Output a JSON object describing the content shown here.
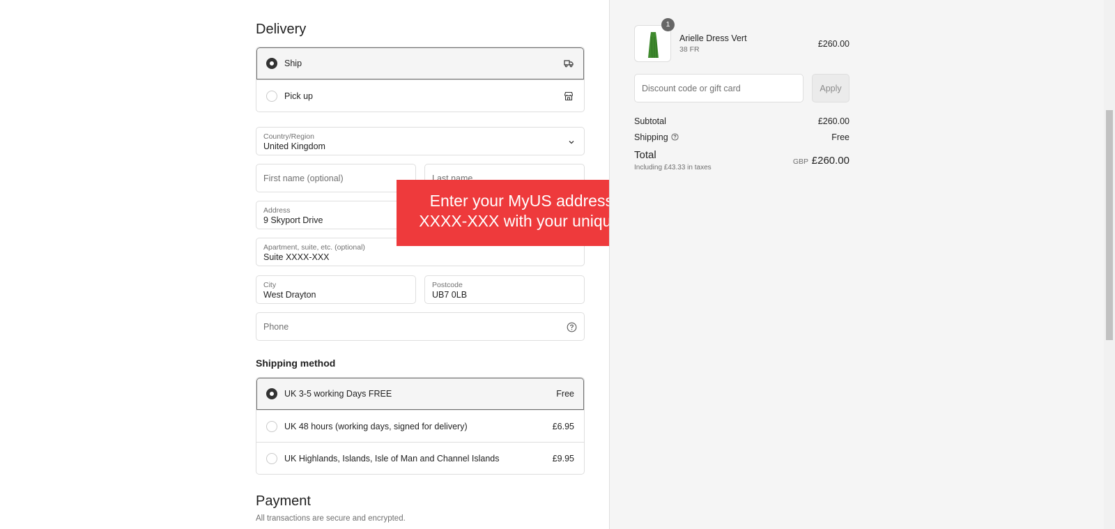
{
  "header": {
    "cut_text": ""
  },
  "delivery": {
    "title": "Delivery",
    "options": [
      {
        "label": "Ship",
        "icon": "truck-icon",
        "selected": true
      },
      {
        "label": "Pick up",
        "icon": "store-icon",
        "selected": false
      }
    ]
  },
  "address_form": {
    "country": {
      "label": "Country/Region",
      "value": "United Kingdom"
    },
    "first_name": {
      "placeholder": "First name (optional)"
    },
    "last_name": {
      "placeholder": "Last name"
    },
    "address": {
      "label": "Address",
      "value": "9 Skyport Drive"
    },
    "apartment": {
      "label": "Apartment, suite, etc. (optional)",
      "value": "Suite XXXX-XXX"
    },
    "city": {
      "label": "City",
      "value": "West Drayton"
    },
    "postcode": {
      "label": "Postcode",
      "value": "UB7 0LB"
    },
    "phone": {
      "placeholder": "Phone"
    }
  },
  "callout": {
    "line1": "Enter your MyUS address here! Update",
    "line2": "XXXX-XXX with your unique suite number.",
    "color": "#ee3a3c"
  },
  "shipping_method": {
    "title": "Shipping method",
    "options": [
      {
        "label": "UK 3-5 working Days FREE",
        "price": "Free",
        "selected": true
      },
      {
        "label": "UK 48 hours (working days, signed for delivery)",
        "price": "£6.95",
        "selected": false
      },
      {
        "label": "UK Highlands, Islands, Isle of Man and Channel Islands",
        "price": "£9.95",
        "selected": false
      }
    ]
  },
  "payment": {
    "title": "Payment",
    "subtitle": "All transactions are secure and encrypted."
  },
  "order_summary": {
    "item": {
      "quantity": "1",
      "name": "Arielle Dress Vert",
      "variant": "38 FR",
      "price": "£260.00",
      "color": "#3f8a2e"
    },
    "discount": {
      "placeholder": "Discount code or gift card",
      "apply_label": "Apply"
    },
    "subtotal": {
      "label": "Subtotal",
      "value": "£260.00"
    },
    "shipping": {
      "label": "Shipping",
      "value": "Free"
    },
    "total": {
      "label": "Total",
      "note": "Including £43.33 in taxes",
      "currency": "GBP",
      "value": "£260.00"
    }
  }
}
